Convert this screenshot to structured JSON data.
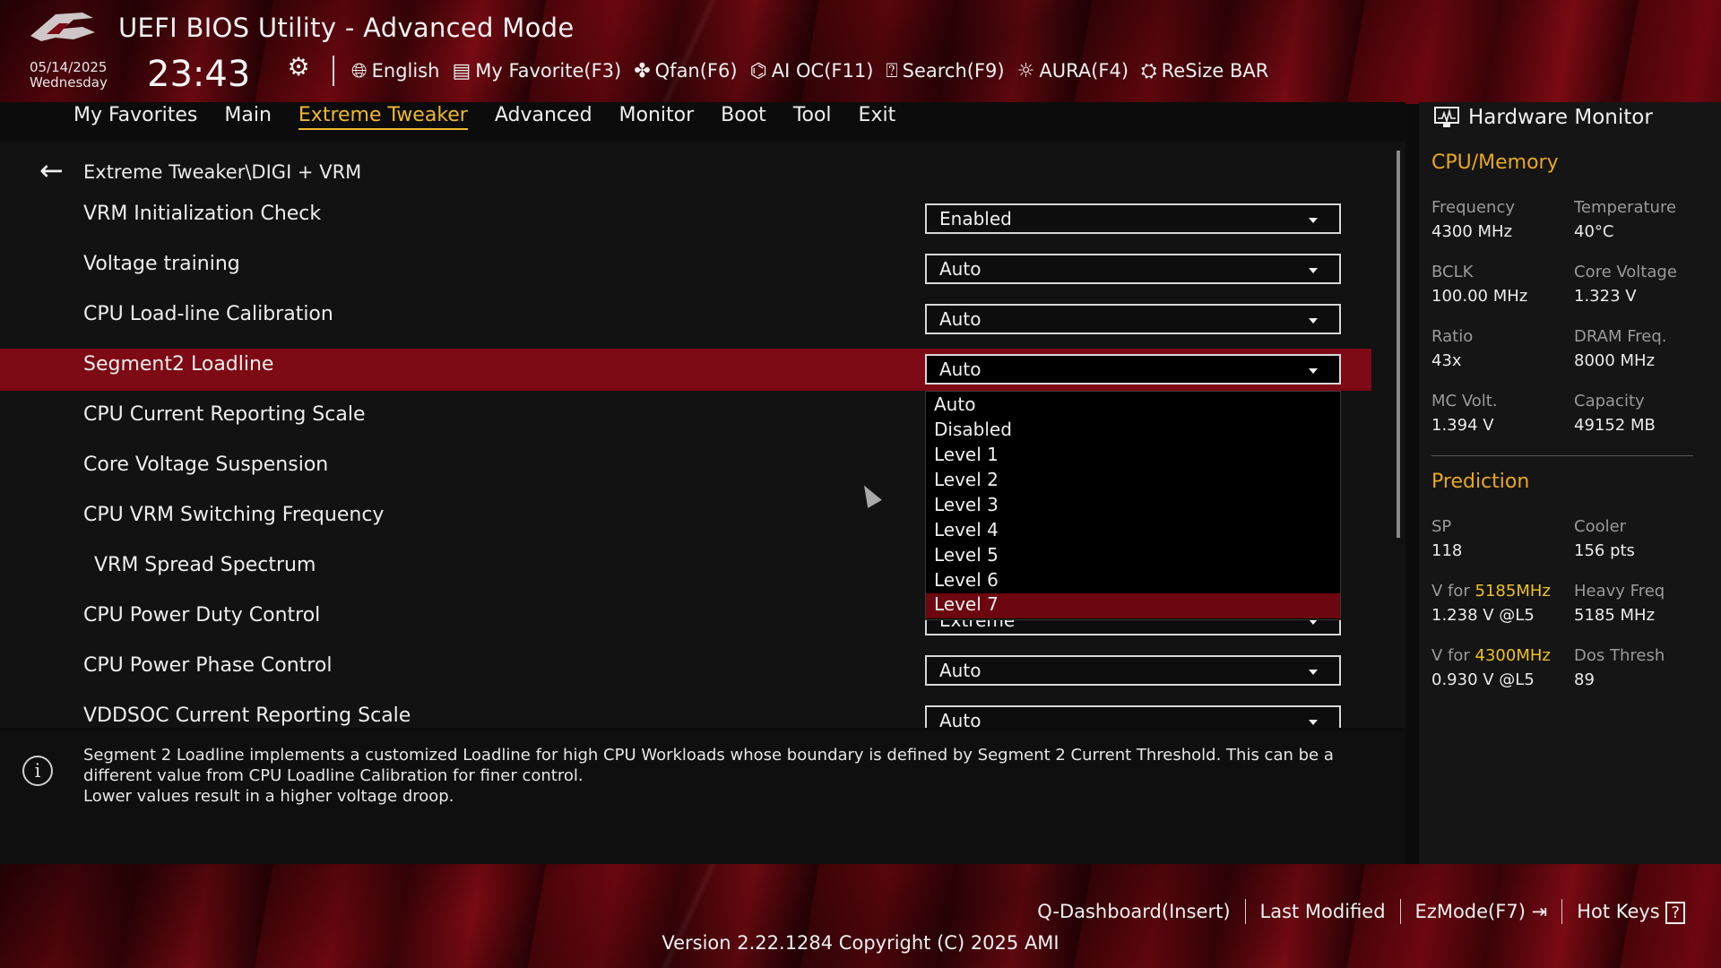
{
  "header": {
    "title": "UEFI BIOS Utility - Advanced Mode",
    "date": "05/14/2025",
    "weekday": "Wednesday",
    "time": "23:43",
    "tools": [
      {
        "icon": "globe-icon",
        "label": "English"
      },
      {
        "icon": "favorite-list-icon",
        "label": "My Favorite(F3)"
      },
      {
        "icon": "fan-icon",
        "label": "Qfan(F6)"
      },
      {
        "icon": "ai-chip-icon",
        "label": "AI OC(F11)"
      },
      {
        "icon": "question-box-icon",
        "label": "Search(F9)"
      },
      {
        "icon": "aura-light-icon",
        "label": "AURA(F4)"
      },
      {
        "icon": "resize-bar-icon",
        "label": "ReSize BAR"
      }
    ]
  },
  "menu": {
    "items": [
      "My Favorites",
      "Main",
      "Extreme Tweaker",
      "Advanced",
      "Monitor",
      "Boot",
      "Tool",
      "Exit"
    ],
    "active": "Extreme Tweaker"
  },
  "main": {
    "breadcrumb": "Extreme Tweaker\\DIGI + VRM",
    "settings": [
      {
        "label": "VRM Initialization Check",
        "value": "Enabled"
      },
      {
        "label": "Voltage training",
        "value": "Auto"
      },
      {
        "label": "CPU Load-line Calibration",
        "value": "Auto"
      },
      {
        "label": "Segment2 Loadline",
        "value": "Auto"
      },
      {
        "label": "CPU Current Reporting Scale",
        "value": ""
      },
      {
        "label": "Core Voltage Suspension",
        "value": ""
      },
      {
        "label": "CPU VRM Switching Frequency",
        "value": ""
      },
      {
        "label": "VRM Spread Spectrum",
        "value": ""
      },
      {
        "label": "CPU Power Duty Control",
        "value": "Extreme"
      },
      {
        "label": "CPU Power Phase Control",
        "value": "Auto"
      },
      {
        "label": "VDDSOC Current Reporting Scale",
        "value": "Auto"
      }
    ],
    "dropdown_options": [
      "Auto",
      "Disabled",
      "Level 1",
      "Level 2",
      "Level 3",
      "Level 4",
      "Level 5",
      "Level 6",
      "Level 7"
    ],
    "highlighted_option": "Level 7"
  },
  "help": {
    "line1": "Segment 2 Loadline implements a customized Loadline for high CPU Workloads whose boundary is defined by Segment 2 Current Threshold. This can be a different value from CPU Loadline Calibration for finer control.",
    "line2": "Lower values result in a higher voltage droop."
  },
  "hardware_monitor": {
    "title": "Hardware Monitor",
    "cpu_memory": {
      "title": "CPU/Memory",
      "items": [
        {
          "key": "Frequency",
          "value": "4300 MHz"
        },
        {
          "key": "Temperature",
          "value": "40°C"
        },
        {
          "key": "BCLK",
          "value": "100.00 MHz"
        },
        {
          "key": "Core Voltage",
          "value": "1.323 V"
        },
        {
          "key": "Ratio",
          "value": "43x"
        },
        {
          "key": "DRAM Freq.",
          "value": "8000 MHz"
        },
        {
          "key": "MC Volt.",
          "value": "1.394 V"
        },
        {
          "key": "Capacity",
          "value": "49152 MB"
        }
      ]
    },
    "prediction": {
      "title": "Prediction",
      "sp_key": "SP",
      "sp_value": "118",
      "cooler_key": "Cooler",
      "cooler_value": "156 pts",
      "v1_prefix": "V for ",
      "v1_freq": "5185MHz",
      "v1_value": "1.238 V @L5",
      "heavy_key": "Heavy Freq",
      "heavy_value": "5185 MHz",
      "v2_prefix": "V for ",
      "v2_freq": "4300MHz",
      "v2_value": "0.930 V @L5",
      "dos_key": "Dos Thresh",
      "dos_value": "89"
    }
  },
  "footer": {
    "links": [
      "Q-Dashboard(Insert)",
      "Last Modified",
      "EzMode(F7)",
      "Hot Keys"
    ],
    "version": "Version 2.22.1284 Copyright (C) 2025 AMI"
  },
  "colors": {
    "accent": "#f0b92e",
    "highlight_row": "#7d0a14",
    "section_title": "#e8a81e"
  }
}
